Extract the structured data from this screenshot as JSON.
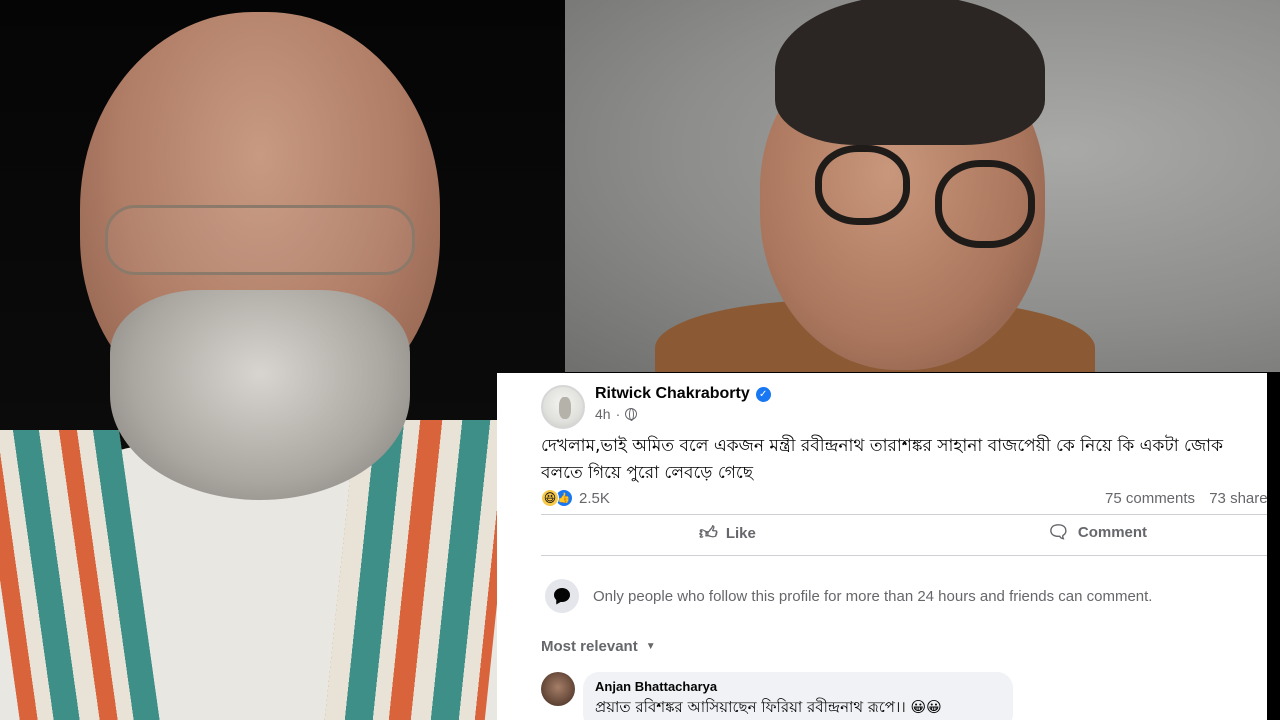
{
  "post": {
    "author_name": "Ritwick Chakraborty",
    "timestamp": "4h",
    "privacy_icon": "globe-icon",
    "verified_icon": "verified-badge-icon",
    "text": "দেখলাম,ভাই অমিত বলে একজন মন্ত্রী রবীন্দ্রনাথ তারাশঙ্কর সাহানা বাজপেয়ী কে নিয়ে কি একটা জোক বলতে গিয়ে পুরো লেবড়ে গেছে",
    "reactions": {
      "icons": [
        "haha-icon",
        "like-icon"
      ],
      "count": "2.5K"
    },
    "comments_count": "75 comments",
    "shares_count": "73 shares",
    "actions": {
      "like_label": "Like",
      "comment_label": "Comment"
    },
    "comment_restriction": "Only people who follow this profile for more than 24 hours and friends can comment.",
    "sort_label": "Most relevant",
    "top_comment": {
      "author": "Anjan Bhattacharya",
      "text": "প্রয়াত রবিশঙ্কর আসিয়াছেন ফিরিয়া রবীন্দ্রনাথ রূপে।। 😀😀"
    }
  },
  "colors": {
    "facebook_blue": "#1877f2",
    "secondary_text": "#65676b",
    "divider": "#ced0d4",
    "comment_bubble": "#f0f2f5"
  }
}
